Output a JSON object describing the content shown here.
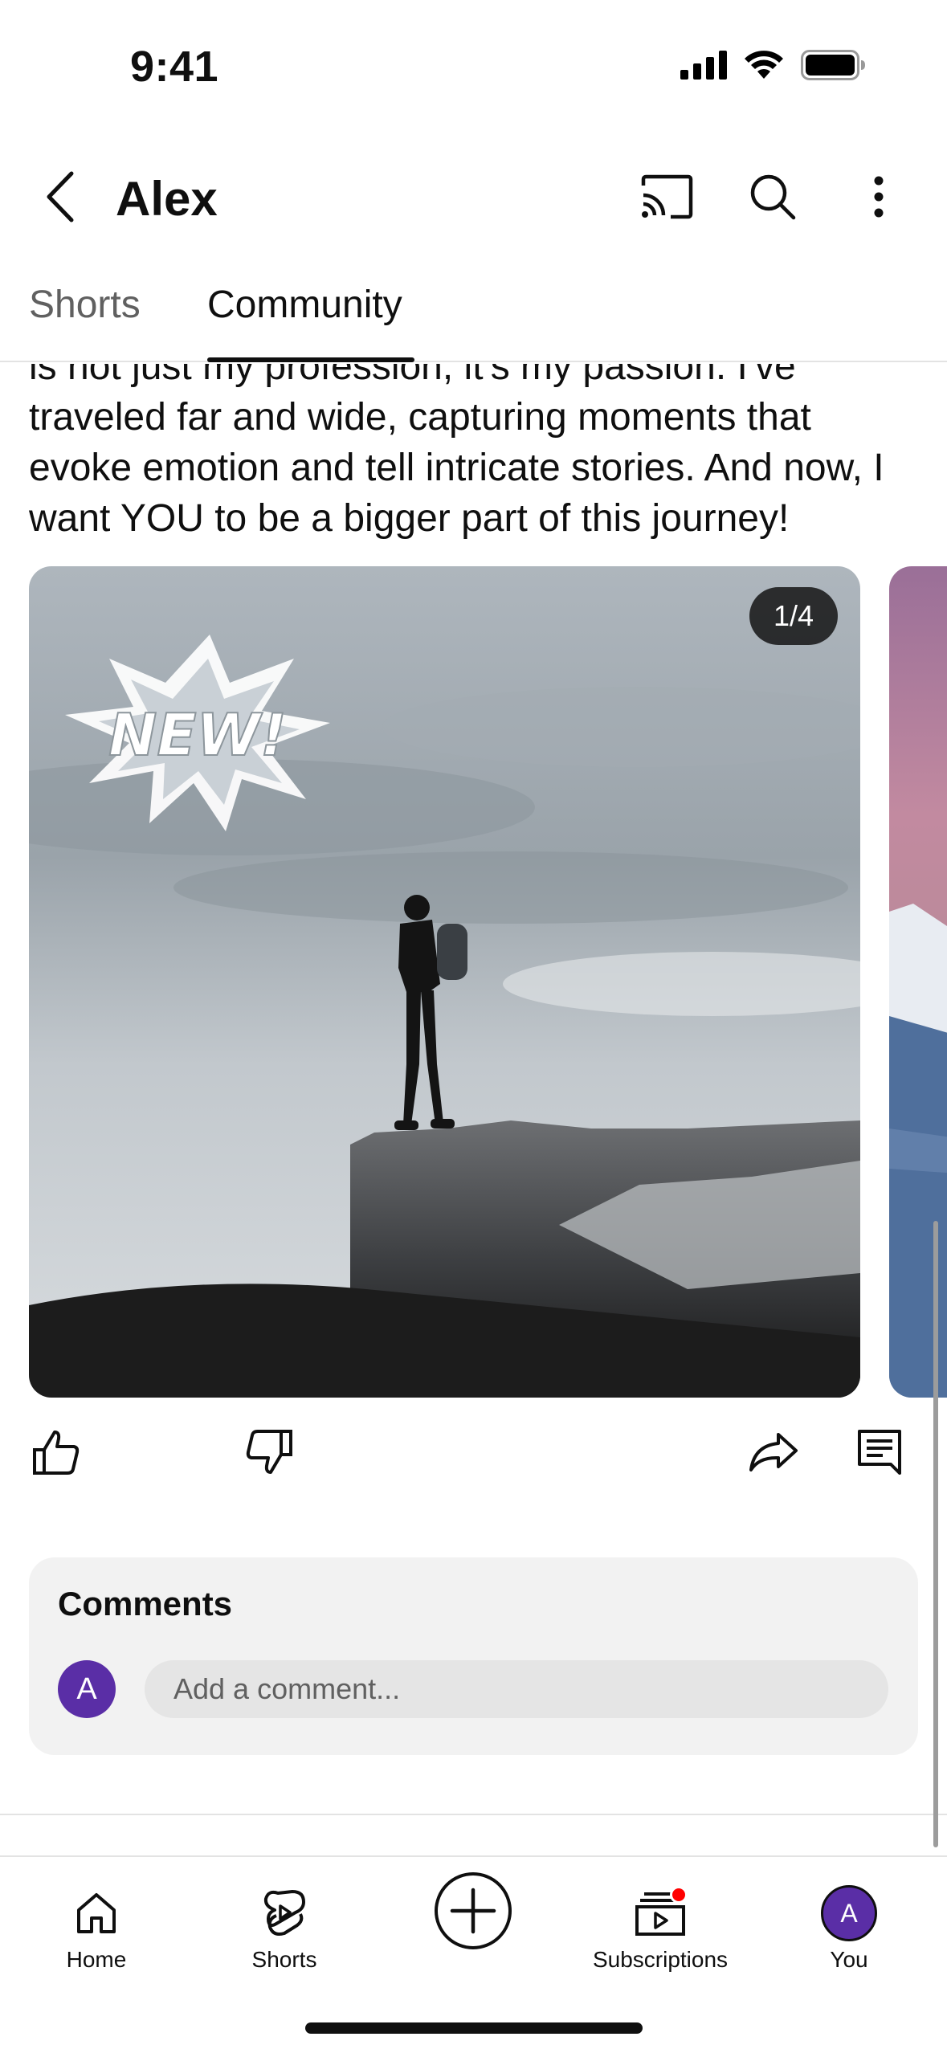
{
  "status_bar": {
    "time": "9:41"
  },
  "header": {
    "title": "Alex"
  },
  "tabs": [
    {
      "label": "Shorts",
      "active": false
    },
    {
      "label": "Community",
      "active": true
    }
  ],
  "post": {
    "text": "is not just my profession, it's my passion. I've traveled far and wide, capturing moments that evoke emotion and tell intricate stories. And now, I want YOU to be a bigger part of this journey!",
    "image_overlay_text": "NEW!",
    "page_indicator": "1/4"
  },
  "comments": {
    "title": "Comments",
    "avatar_initial": "A",
    "placeholder": "Add a comment..."
  },
  "bottom_nav": [
    {
      "label": "Home",
      "icon": "home-icon"
    },
    {
      "label": "Shorts",
      "icon": "shorts-icon"
    },
    {
      "label": "",
      "icon": "create-icon"
    },
    {
      "label": "Subscriptions",
      "icon": "subscriptions-icon",
      "notification": true
    },
    {
      "label": "You",
      "icon": "avatar",
      "initial": "A"
    }
  ],
  "colors": {
    "accent_avatar": "#5a2ea6",
    "notification": "#ff0000",
    "text_primary": "#0f0f0f",
    "text_secondary": "#606060"
  }
}
